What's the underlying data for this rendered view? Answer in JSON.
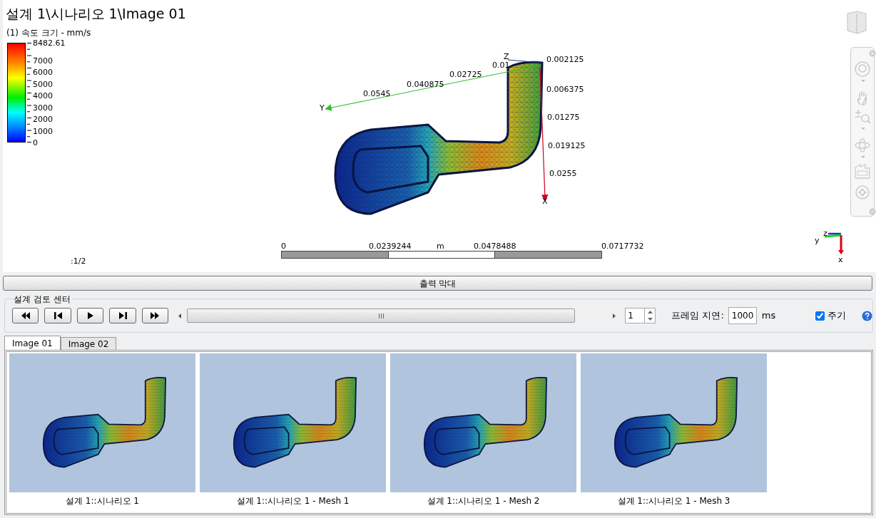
{
  "view": {
    "title": "설계 1\\시나리오 1\\Image 01",
    "legend": {
      "title": "(1) 속도 크기 - mm/s",
      "labels": [
        "8482.61",
        "7000",
        "6000",
        "5000",
        "4000",
        "3000",
        "2000",
        "1000",
        "0"
      ]
    },
    "axes": {
      "z_label": "Z",
      "z_tick": "0.002125",
      "y_label": "Y",
      "y_ticks": [
        "0.0545",
        "0.040875",
        "0.02725",
        "0.01"
      ],
      "x_label": "X",
      "x_ticks": [
        "0.006375",
        "0.01275",
        "0.019125",
        "0.0255"
      ]
    },
    "scale_bar": {
      "labels": [
        "0",
        "0.0239244",
        "0.0478488",
        "0.0717732"
      ],
      "unit": "m"
    },
    "zoom_ratio": ":1/2",
    "triad": {
      "x": "x",
      "y": "y",
      "z": "z"
    }
  },
  "output_bar_button": "출력 막대",
  "review_center": {
    "title": "설계 검토 센터",
    "frame": "1",
    "frame_delay_label": "프레임 지연:",
    "frame_delay": "1000",
    "unit": "ms",
    "loop": {
      "label": "주기",
      "checked": true
    }
  },
  "tabs": [
    {
      "label": "Image 01",
      "selected": true
    },
    {
      "label": "Image 02",
      "selected": false
    }
  ],
  "thumbnails": [
    {
      "caption": "설계 1::시나리오 1"
    },
    {
      "caption": "설계 1::시나리오 1 - Mesh 1"
    },
    {
      "caption": "설계 1::시나리오 1 - Mesh 2"
    },
    {
      "caption": "설계 1::시나리오 1 - Mesh 3"
    }
  ]
}
